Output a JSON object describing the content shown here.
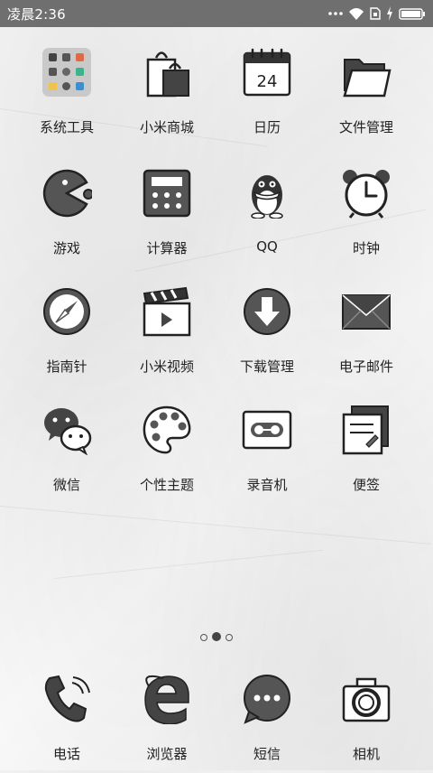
{
  "status_bar": {
    "time": "凌晨2:36",
    "icons": [
      "more-dots-icon",
      "wifi-icon",
      "sim-icon",
      "charging-icon",
      "battery-icon"
    ]
  },
  "apps": [
    {
      "label": "系统工具",
      "icon": "system-tools-folder-icon"
    },
    {
      "label": "小米商城",
      "icon": "shopping-bag-icon"
    },
    {
      "label": "日历",
      "icon": "calendar-icon",
      "calendar_day": "24"
    },
    {
      "label": "文件管理",
      "icon": "folder-icon"
    },
    {
      "label": "游戏",
      "icon": "pacman-icon"
    },
    {
      "label": "计算器",
      "icon": "calculator-icon"
    },
    {
      "label": "QQ",
      "icon": "penguin-icon"
    },
    {
      "label": "时钟",
      "icon": "alarm-clock-icon"
    },
    {
      "label": "指南针",
      "icon": "compass-icon"
    },
    {
      "label": "小米视频",
      "icon": "clapperboard-icon"
    },
    {
      "label": "下载管理",
      "icon": "download-icon"
    },
    {
      "label": "电子邮件",
      "icon": "envelope-icon"
    },
    {
      "label": "微信",
      "icon": "wechat-icon"
    },
    {
      "label": "个性主题",
      "icon": "palette-icon"
    },
    {
      "label": "录音机",
      "icon": "cassette-icon"
    },
    {
      "label": "便签",
      "icon": "notes-icon"
    }
  ],
  "page_indicator": {
    "pages": 3,
    "active": 2
  },
  "dock": [
    {
      "label": "电话",
      "icon": "phone-icon"
    },
    {
      "label": "浏览器",
      "icon": "browser-icon"
    },
    {
      "label": "短信",
      "icon": "message-icon"
    },
    {
      "label": "相机",
      "icon": "camera-icon"
    }
  ],
  "colors": {
    "status_bar": "#6f6f6f",
    "ink": "#222222",
    "fill": "#555555"
  }
}
